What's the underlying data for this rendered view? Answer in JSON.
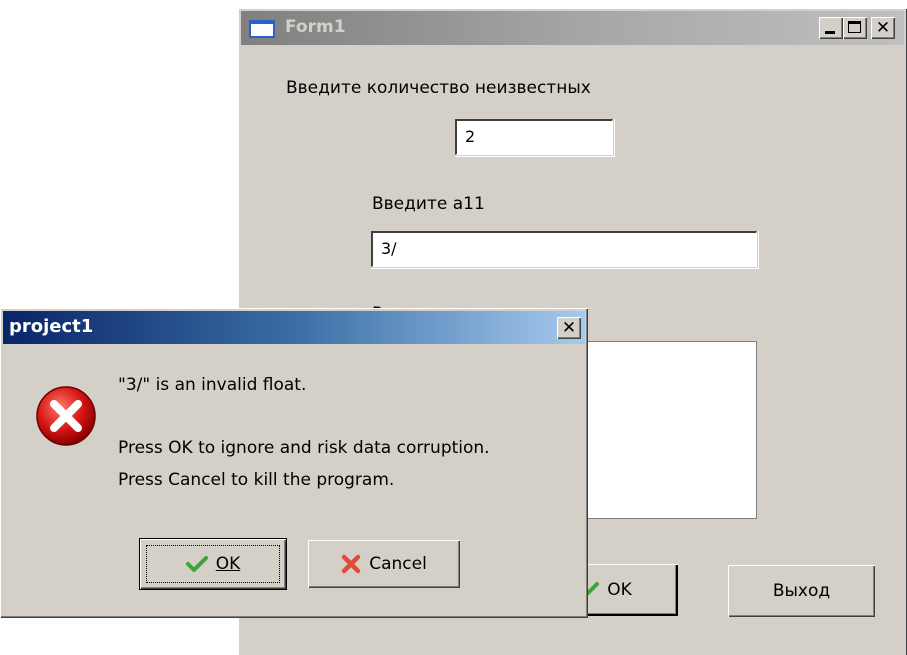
{
  "form1": {
    "title": "Form1",
    "label_count": "Введите количество неизвестных",
    "count_value": "2",
    "label_coeff": "Введите a11",
    "coeff_value": "3/",
    "label_solution": "Решение",
    "ok_button_label": "OK",
    "exit_button_label": "Выход",
    "title_buttons": {
      "minimize": "_",
      "maximize": "□",
      "close": "✕"
    }
  },
  "dialog": {
    "title": "project1",
    "message_line1": "\"3/\" is an invalid float.",
    "message_line2": "Press OK to ignore and risk data corruption.",
    "message_line3": "Press Cancel to kill the program.",
    "ok_label": "OK",
    "cancel_label": "Cancel",
    "close_glyph": "✕",
    "icon": "error-icon"
  },
  "colors": {
    "window_face": "#d4d0c8",
    "active_title_start": "#0a246a",
    "active_title_end": "#a6caf0",
    "inactive_title": "#808080",
    "error_red": "#d61515",
    "ok_check_green": "#3aa53a",
    "cancel_x_red": "#e04a3a"
  }
}
